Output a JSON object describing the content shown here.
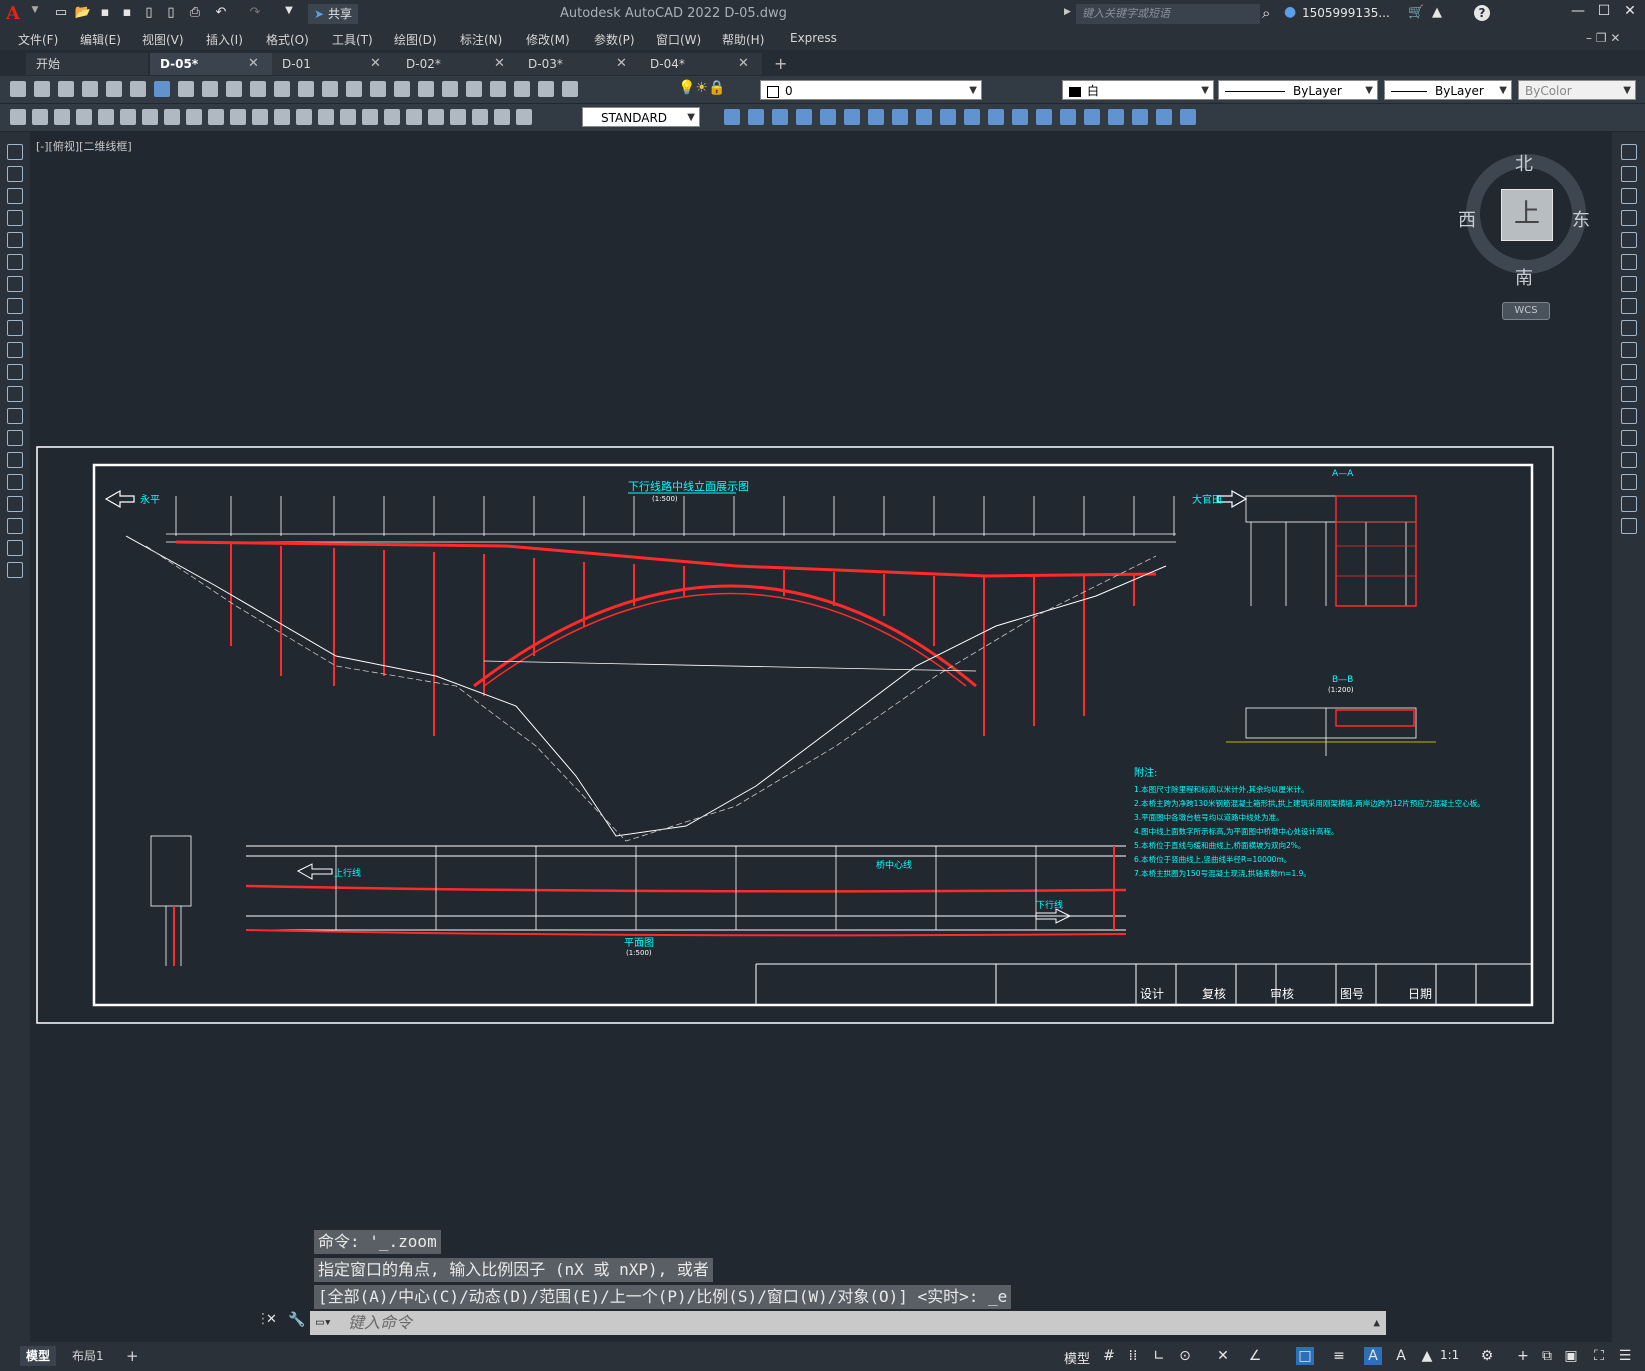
{
  "app": {
    "title": "Autodesk AutoCAD 2022    D-05.dwg"
  },
  "quick_access": {
    "share_label": "共享"
  },
  "search": {
    "placeholder": "键入关键字或短语"
  },
  "user": {
    "name": "1505999135..."
  },
  "menus": [
    "文件(F)",
    "编辑(E)",
    "视图(V)",
    "插入(I)",
    "格式(O)",
    "工具(T)",
    "绘图(D)",
    "标注(N)",
    "修改(M)",
    "参数(P)",
    "窗口(W)",
    "帮助(H)",
    "Express"
  ],
  "tabs": [
    {
      "label": "开始",
      "active": false
    },
    {
      "label": "D-05*",
      "active": true
    },
    {
      "label": "D-01",
      "active": false
    },
    {
      "label": "D-02*",
      "active": false
    },
    {
      "label": "D-03*",
      "active": false
    },
    {
      "label": "D-04*",
      "active": false
    }
  ],
  "tab_add": "+",
  "layer": {
    "current": "0"
  },
  "properties": {
    "color": "白",
    "linetype": "ByLayer",
    "lineweight": "ByLayer",
    "plotstyle": "ByColor"
  },
  "textstyle": {
    "current": "STANDARD"
  },
  "viewport": {
    "label": "[-][俯视][二维线框]"
  },
  "viewcube": {
    "north": "北",
    "south": "南",
    "east": "东",
    "west": "西",
    "face": "上",
    "wcs": "WCS"
  },
  "drawing": {
    "title_elev": "下行线路中线立面展示图",
    "scale_elev": "(1:500)",
    "left_label": "永平",
    "right_label": "大官田",
    "section_aa": "A—A",
    "section_bb": "B—B",
    "scale_bb": "(1:200)",
    "plan_title": "平面图",
    "plan_scale": "(1:500)",
    "plan_up": "上行线",
    "plan_down": "下行线",
    "plan_center": "桥中心线",
    "notes_title": "附注:",
    "notes": [
      "1.本图尺寸除里程和标高以米计外,其余均以厘米计。",
      "2.本桥主跨为净跨130米钢筋混凝土箱形拱,拱上建筑采用刚架横墙,两岸边跨为12片预应力混凝土空心板。",
      "3.平面图中各墩台桩号均以道路中线处为准。",
      "4.图中线上面数字所示标高,为平面图中桥墩中心处设计高程。",
      "5.本桥位于直线与缓和曲线上,桥面横坡为双向2%。",
      "6.本桥位于竖曲线上,竖曲线半径R=10000m。",
      "7.本桥主拱圈为150号混凝土现浇,拱轴系数m=1.9。"
    ],
    "title_block": [
      "设计",
      "复核",
      "审核",
      "图号",
      "日期"
    ]
  },
  "command": {
    "history": [
      "命令: '_.zoom",
      "指定窗口的角点, 输入比例因子 (nX 或 nXP), 或者",
      "[全部(A)/中心(C)/动态(D)/范围(E)/上一个(P)/比例(S)/窗口(W)/对象(O)] <实时>: _e"
    ],
    "placeholder": "键入命令"
  },
  "status": {
    "layout_tabs": [
      {
        "label": "模型",
        "active": true
      },
      {
        "label": "布局1",
        "active": false
      }
    ],
    "model_label": "模型",
    "scale": "1:1"
  }
}
